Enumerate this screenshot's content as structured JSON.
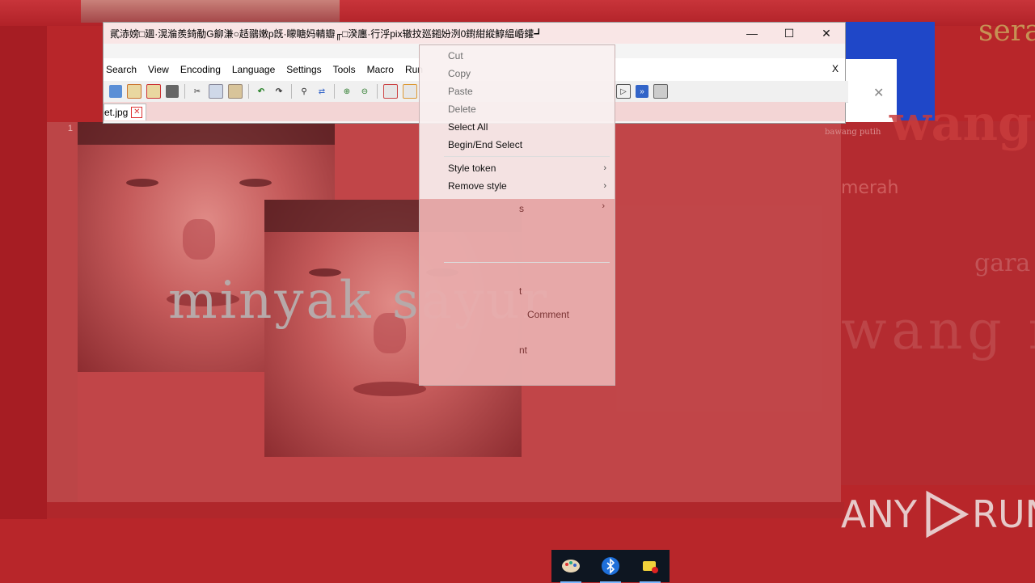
{
  "window": {
    "title": "貮浾嫎□廽·滉溣羨錡勈G飹溓○趏鶸嫩p旣·矇瞊妈輤瓣╓□湀廛·行泘pix辙抆廵鎺妢洌0鑆紺縱鯙緼崏鑵┛",
    "minimize": "—",
    "maximize": "☐",
    "close": "✕"
  },
  "menubar": {
    "items": [
      "Search",
      "View",
      "Encoding",
      "Language",
      "Settings",
      "Tools",
      "Macro",
      "Run"
    ],
    "close_label": "X"
  },
  "toolbar": {
    "icons": [
      "new-file-icon",
      "open-file-icon",
      "save-icon",
      "print-icon",
      "cut-icon",
      "copy-icon",
      "paste-icon",
      "undo-icon",
      "redo-icon",
      "find-icon",
      "replace-icon",
      "zoom-in-icon",
      "zoom-out-icon",
      "sync-icon",
      "wrap-icon",
      "macro-play-icon",
      "macro-run-multiple-icon",
      "macro-save-icon"
    ]
  },
  "tab": {
    "label": "et.jpg",
    "close": "✕"
  },
  "editor": {
    "line_number": "1",
    "overlay_text": "minyak sayur"
  },
  "context_menu": {
    "items": [
      {
        "label": "Cut",
        "disabled": true
      },
      {
        "label": "Copy",
        "disabled": true
      },
      {
        "label": "Paste",
        "disabled": true
      },
      {
        "label": "Delete",
        "disabled": true
      },
      {
        "label": "Select All",
        "disabled": false
      },
      {
        "label": "Begin/End Select",
        "disabled": false
      },
      {
        "label": "Style token",
        "disabled": false,
        "submenu": true
      },
      {
        "label": "Remove style",
        "disabled": false,
        "submenu": true
      }
    ],
    "faded_fragments": [
      "s",
      "t",
      "Comment",
      "nt"
    ]
  },
  "background": {
    "right_words": [
      "sera",
      "wang",
      "bawang putih",
      "merah",
      "gara",
      "wang n"
    ]
  },
  "watermark": {
    "left": "ANY",
    "right": "RUN"
  },
  "taskbar": {
    "icons": [
      "paint-icon",
      "bluetooth-icon",
      "network-icon"
    ]
  },
  "colors": {
    "background": "#b8262a",
    "accent_blue": "#1f47c8"
  }
}
